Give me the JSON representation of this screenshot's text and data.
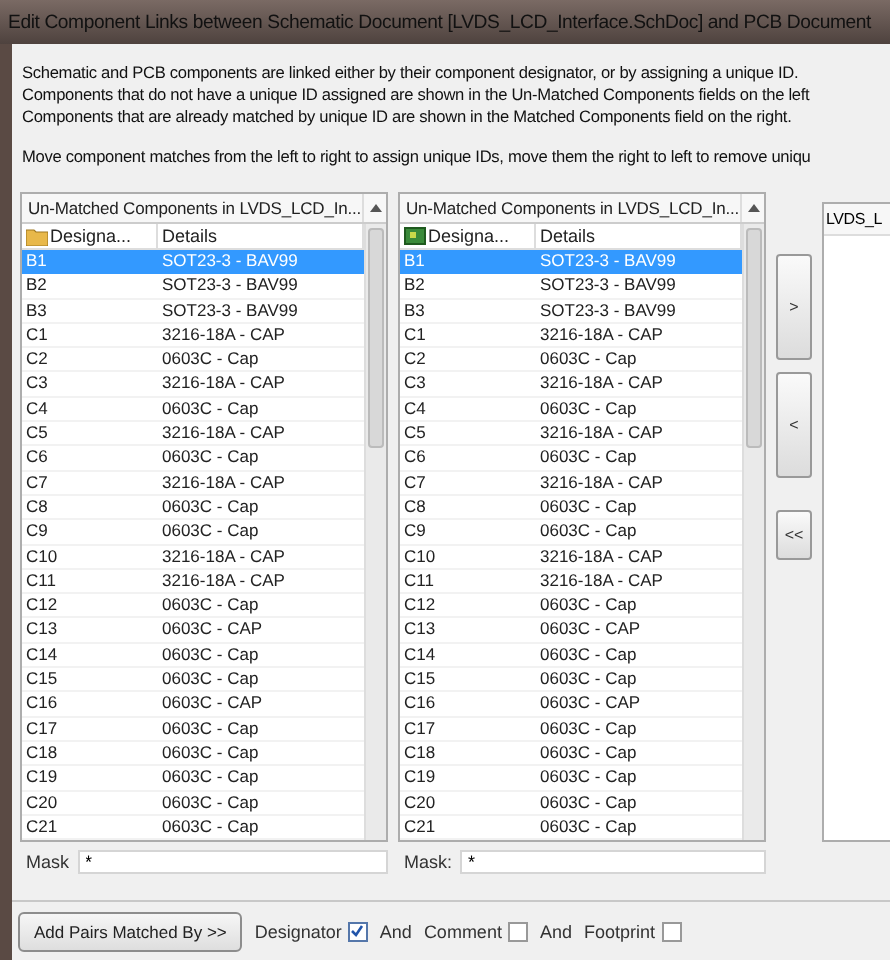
{
  "window": {
    "title": "Edit Component Links between Schematic Document [LVDS_LCD_Interface.SchDoc] and PCB Document"
  },
  "description": [
    "Schematic and PCB components are linked either by their component designator, or by assigning a unique ID.",
    "Components that do not have a unique ID assigned are shown in the Un-Matched Components fields on the left",
    "Components that are already matched by unique ID are shown in the Matched Components field on the right."
  ],
  "instruction": "Move component matches from the left to right to assign unique IDs, move them the right to left to remove uniqu",
  "lists": [
    {
      "title": "Un-Matched Components in LVDS_LCD_In...",
      "columns": [
        "Designa...",
        "Details"
      ],
      "mask": {
        "label": "Mask",
        "value": "*"
      },
      "rows": [
        {
          "designator": "B1",
          "details": "SOT23-3 - BAV99",
          "selected": true
        },
        {
          "designator": "B2",
          "details": "SOT23-3 - BAV99",
          "selected": false
        },
        {
          "designator": "B3",
          "details": "SOT23-3 - BAV99",
          "selected": false
        },
        {
          "designator": "C1",
          "details": "3216-18A - CAP",
          "selected": false
        },
        {
          "designator": "C2",
          "details": "0603C - Cap",
          "selected": false
        },
        {
          "designator": "C3",
          "details": "3216-18A - CAP",
          "selected": false
        },
        {
          "designator": "C4",
          "details": "0603C - Cap",
          "selected": false
        },
        {
          "designator": "C5",
          "details": "3216-18A - CAP",
          "selected": false
        },
        {
          "designator": "C6",
          "details": "0603C - Cap",
          "selected": false
        },
        {
          "designator": "C7",
          "details": "3216-18A - CAP",
          "selected": false
        },
        {
          "designator": "C8",
          "details": "0603C - Cap",
          "selected": false
        },
        {
          "designator": "C9",
          "details": "0603C - Cap",
          "selected": false
        },
        {
          "designator": "C10",
          "details": "3216-18A - CAP",
          "selected": false
        },
        {
          "designator": "C11",
          "details": "3216-18A - CAP",
          "selected": false
        },
        {
          "designator": "C12",
          "details": "0603C - Cap",
          "selected": false
        },
        {
          "designator": "C13",
          "details": "0603C - CAP",
          "selected": false
        },
        {
          "designator": "C14",
          "details": "0603C - Cap",
          "selected": false
        },
        {
          "designator": "C15",
          "details": "0603C - Cap",
          "selected": false
        },
        {
          "designator": "C16",
          "details": "0603C - CAP",
          "selected": false
        },
        {
          "designator": "C17",
          "details": "0603C - Cap",
          "selected": false
        },
        {
          "designator": "C18",
          "details": "0603C - Cap",
          "selected": false
        },
        {
          "designator": "C19",
          "details": "0603C - Cap",
          "selected": false
        },
        {
          "designator": "C20",
          "details": "0603C - Cap",
          "selected": false
        },
        {
          "designator": "C21",
          "details": "0603C - Cap",
          "selected": false
        }
      ]
    },
    {
      "title": "Un-Matched Components in LVDS_LCD_In...",
      "columns": [
        "Designa...",
        "Details"
      ],
      "mask": {
        "label": "Mask:",
        "value": "*"
      },
      "rows": [
        {
          "designator": "B1",
          "details": "SOT23-3 - BAV99",
          "selected": true
        },
        {
          "designator": "B2",
          "details": "SOT23-3 - BAV99",
          "selected": false
        },
        {
          "designator": "B3",
          "details": "SOT23-3 - BAV99",
          "selected": false
        },
        {
          "designator": "C1",
          "details": "3216-18A - CAP",
          "selected": false
        },
        {
          "designator": "C2",
          "details": "0603C - Cap",
          "selected": false
        },
        {
          "designator": "C3",
          "details": "3216-18A - CAP",
          "selected": false
        },
        {
          "designator": "C4",
          "details": "0603C - Cap",
          "selected": false
        },
        {
          "designator": "C5",
          "details": "3216-18A - CAP",
          "selected": false
        },
        {
          "designator": "C6",
          "details": "0603C - Cap",
          "selected": false
        },
        {
          "designator": "C7",
          "details": "3216-18A - CAP",
          "selected": false
        },
        {
          "designator": "C8",
          "details": "0603C - Cap",
          "selected": false
        },
        {
          "designator": "C9",
          "details": "0603C - Cap",
          "selected": false
        },
        {
          "designator": "C10",
          "details": "3216-18A - CAP",
          "selected": false
        },
        {
          "designator": "C11",
          "details": "3216-18A - CAP",
          "selected": false
        },
        {
          "designator": "C12",
          "details": "0603C - Cap",
          "selected": false
        },
        {
          "designator": "C13",
          "details": "0603C - CAP",
          "selected": false
        },
        {
          "designator": "C14",
          "details": "0603C - Cap",
          "selected": false
        },
        {
          "designator": "C15",
          "details": "0603C - Cap",
          "selected": false
        },
        {
          "designator": "C16",
          "details": "0603C - CAP",
          "selected": false
        },
        {
          "designator": "C17",
          "details": "0603C - Cap",
          "selected": false
        },
        {
          "designator": "C18",
          "details": "0603C - Cap",
          "selected": false
        },
        {
          "designator": "C19",
          "details": "0603C - Cap",
          "selected": false
        },
        {
          "designator": "C20",
          "details": "0603C - Cap",
          "selected": false
        },
        {
          "designator": "C21",
          "details": "0603C - Cap",
          "selected": false
        }
      ]
    }
  ],
  "move_buttons": [
    ">",
    "<",
    "<<"
  ],
  "right_panel": {
    "title": "LVDS_L"
  },
  "footer": {
    "button": "Add Pairs Matched By >>",
    "items": [
      {
        "kind": "check",
        "label": "Designator",
        "checked": true
      },
      {
        "kind": "text",
        "label": "And"
      },
      {
        "kind": "check",
        "label": "Comment",
        "checked": false
      },
      {
        "kind": "text",
        "label": "And"
      },
      {
        "kind": "check",
        "label": "Footprint",
        "checked": false
      }
    ]
  }
}
